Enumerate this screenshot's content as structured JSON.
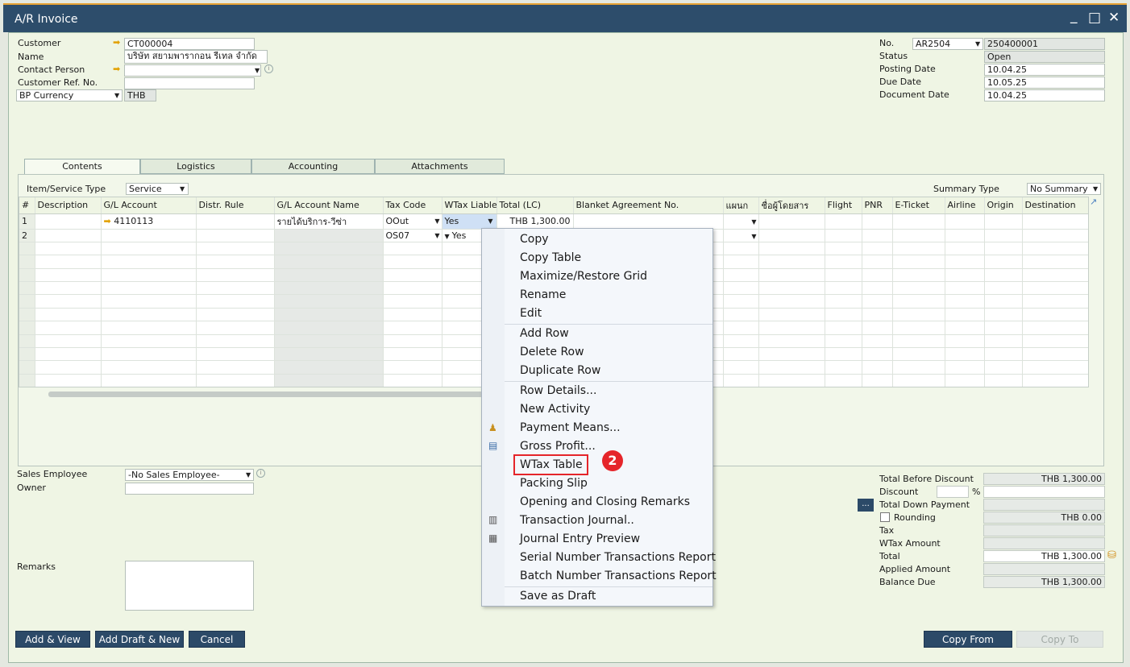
{
  "window": {
    "title": "A/R Invoice",
    "min": "_",
    "max": "□",
    "close": "✕"
  },
  "header": {
    "customer_label": "Customer",
    "customer_value": "CT000004",
    "name_label": "Name",
    "name_value": "บริษัท สยามพารากอน รีเทล จำกัด",
    "contact_label": "Contact Person",
    "contact_value": "",
    "custref_label": "Customer Ref. No.",
    "custref_value": "",
    "currency_label": "BP Currency",
    "currency_value": "THB",
    "no_label": "No.",
    "no_series": "AR2504",
    "no_value": "250400001",
    "status_label": "Status",
    "status_value": "Open",
    "posting_label": "Posting Date",
    "posting_value": "10.04.25",
    "due_label": "Due Date",
    "due_value": "10.05.25",
    "docdate_label": "Document Date",
    "docdate_value": "10.04.25"
  },
  "tabs": [
    "Contents",
    "Logistics",
    "Accounting",
    "Attachments"
  ],
  "contents": {
    "type_label": "Item/Service Type",
    "type_value": "Service",
    "summary_label": "Summary Type",
    "summary_value": "No Summary"
  },
  "grid": {
    "columns": [
      "#",
      "Description",
      "G/L Account",
      "Distr. Rule",
      "G/L Account Name",
      "Tax Code",
      "WTax Liable",
      "Total (LC)",
      "Blanket Agreement No.",
      "แผนก",
      "ชื่อผู้โดยสาร",
      "Flight",
      "PNR",
      "E-Ticket",
      "Airline",
      "Origin",
      "Destination"
    ],
    "rows": [
      {
        "num": "1",
        "gl": "4110113",
        "glname": "รายได้บริการ-วีซ่า",
        "tax": "OOut",
        "wtax": "Yes",
        "total": "THB 1,300.00"
      },
      {
        "num": "2",
        "gl": "",
        "glname": "",
        "tax": "OS07",
        "wtax": "Yes",
        "total": ""
      }
    ]
  },
  "menu": {
    "items": [
      "Copy",
      "Copy Table",
      "Maximize/Restore Grid",
      "Rename",
      "Edit",
      "Add Row",
      "Delete Row",
      "Duplicate Row",
      "Row Details...",
      "New Activity",
      "Payment Means...",
      "Gross Profit...",
      "WTax Table",
      "Packing Slip",
      "Opening and Closing Remarks",
      "Transaction Journal..",
      "Journal Entry Preview",
      "Serial Number Transactions Report",
      "Batch Number Transactions Report",
      "Save as Draft"
    ],
    "highlighted": "WTax Table",
    "step_badge": "2"
  },
  "footer": {
    "sales_label": "Sales Employee",
    "sales_value": "-No Sales Employee-",
    "owner_label": "Owner",
    "remarks_label": "Remarks",
    "total_before_label": "Total Before Discount",
    "total_before_value": "THB 1,300.00",
    "discount_label": "Discount",
    "percent": "%",
    "down_payment_label": "Total Down Payment",
    "dots": "...",
    "rounding_label": "Rounding",
    "rounding_value": "THB 0.00",
    "tax_label": "Tax",
    "wtax_amount_label": "WTax Amount",
    "total_label": "Total",
    "total_value": "THB 1,300.00",
    "applied_label": "Applied Amount",
    "balance_label": "Balance Due",
    "balance_value": "THB 1,300.00"
  },
  "buttons": {
    "add_view": "Add & View",
    "add_draft_new": "Add Draft & New",
    "cancel": "Cancel",
    "copy_from": "Copy From",
    "copy_to": "Copy To"
  },
  "colors": {
    "titlebar": "#2d4d6b",
    "accent": "#e7a233",
    "window_bg": "#eff5e4",
    "highlight": "#e5252a"
  }
}
